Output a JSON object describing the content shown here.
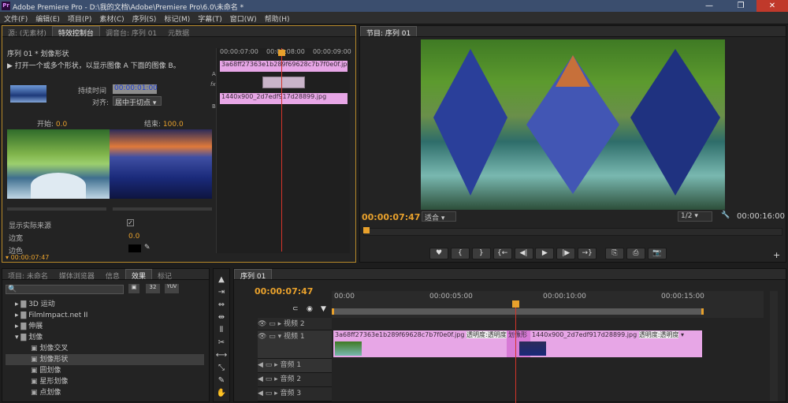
{
  "app": {
    "icon_text": "Pr",
    "title": "Adobe Premiere Pro - D:\\我的文档\\Adobe\\Premiere Pro\\6.0\\未命名 *"
  },
  "window_controls": {
    "minimize": "—",
    "maximize": "❐",
    "close": "✕"
  },
  "menu": [
    "文件(F)",
    "编辑(E)",
    "项目(P)",
    "素材(C)",
    "序列(S)",
    "标记(M)",
    "字幕(T)",
    "窗口(W)",
    "帮助(H)"
  ],
  "effect_controls": {
    "tabs": [
      "源: (无素材)",
      "特效控制台",
      "调音台: 序列 01",
      "元数据"
    ],
    "active_tab": "特效控制台",
    "header": "序列 01 * 划像形状",
    "description": "打开一个或多个形状，以显示图像 A 下面的图像 B。",
    "duration_label": "持续时间",
    "duration_value": "00:00:01:00",
    "align_label": "对齐:",
    "align_value": "居中于切点",
    "start_label": "开始:",
    "start_value": "0.0",
    "end_label": "结束:",
    "end_value": "100.0",
    "show_actual_label": "显示实际来源",
    "border_width_label": "边宽",
    "border_width_value": "0.0",
    "border_color_label": "边色",
    "timecode": "00:00:07:47",
    "mini_ruler": [
      "00:00:07:00",
      "00:00:08:00",
      "00:00:09:00"
    ],
    "track_a_clip": "3a68ff27363e1b289f69628c7b7f0e0f.jpg",
    "track_b_clip": "1440x900_2d7edf917d28899.jpg",
    "track_a": "A",
    "track_b": "B",
    "fx": "fx"
  },
  "program_monitor": {
    "tab": "节目: 序列 01",
    "timecode": "00:00:07:47",
    "fit": "适合",
    "ratio": "1/2",
    "duration": "00:00:16:00",
    "controls": [
      "♥",
      "{",
      "}",
      "{←",
      "◀|",
      "▶",
      "|▶",
      "→}",
      "⎘",
      "⎙",
      "📷"
    ]
  },
  "project_panel": {
    "tabs": [
      "项目: 未命名",
      "媒体浏览器",
      "信息",
      "效果",
      "标记"
    ],
    "active_tab": "效果",
    "search_placeholder": "",
    "badge_32": "32",
    "badge_yuv": "YUV",
    "tree": [
      {
        "label": "3D 运动",
        "level": 1,
        "type": "folder",
        "expanded": false
      },
      {
        "label": "FilmImpact.net II",
        "level": 1,
        "type": "folder",
        "expanded": false
      },
      {
        "label": "伸展",
        "level": 1,
        "type": "folder",
        "expanded": false
      },
      {
        "label": "划像",
        "level": 1,
        "type": "folder",
        "expanded": true
      },
      {
        "label": "划像交叉",
        "level": 2,
        "type": "effect"
      },
      {
        "label": "划像形状",
        "level": 2,
        "type": "effect",
        "selected": true
      },
      {
        "label": "圆划像",
        "level": 2,
        "type": "effect"
      },
      {
        "label": "星形划像",
        "level": 2,
        "type": "effect"
      },
      {
        "label": "点划像",
        "level": 2,
        "type": "effect"
      }
    ]
  },
  "timeline": {
    "tab": "序列 01",
    "timecode": "00:00:07:47",
    "ruler": [
      "00:00",
      "00:00:05:00",
      "00:00:10:00",
      "00:00:15:00"
    ],
    "tracks": [
      {
        "name": "视频 2"
      },
      {
        "name": "视频 1"
      },
      {
        "name": "音频 1"
      },
      {
        "name": "音频 2"
      },
      {
        "name": "音频 3"
      }
    ],
    "clip1_name": "3a68ff27363e1b289f69628c7b7f0e0f.jpg",
    "clip1_opacity": "透明度:透明度",
    "transition_label": "划像形",
    "clip2_name": "1440x900_2d7edf917d28899.jpg",
    "clip2_opacity": "透明度:透明度"
  },
  "tools": [
    "▲",
    "⇥",
    "⇔",
    "⇹",
    "⫴",
    "✂",
    "⟷",
    "⤡",
    "✎",
    "✋",
    "🔍"
  ],
  "colors": {
    "accent": "#e8a12c",
    "clip_pink": "#e7a6e6",
    "clip_purple": "#d77ad6",
    "playhead": "#d4342a"
  }
}
